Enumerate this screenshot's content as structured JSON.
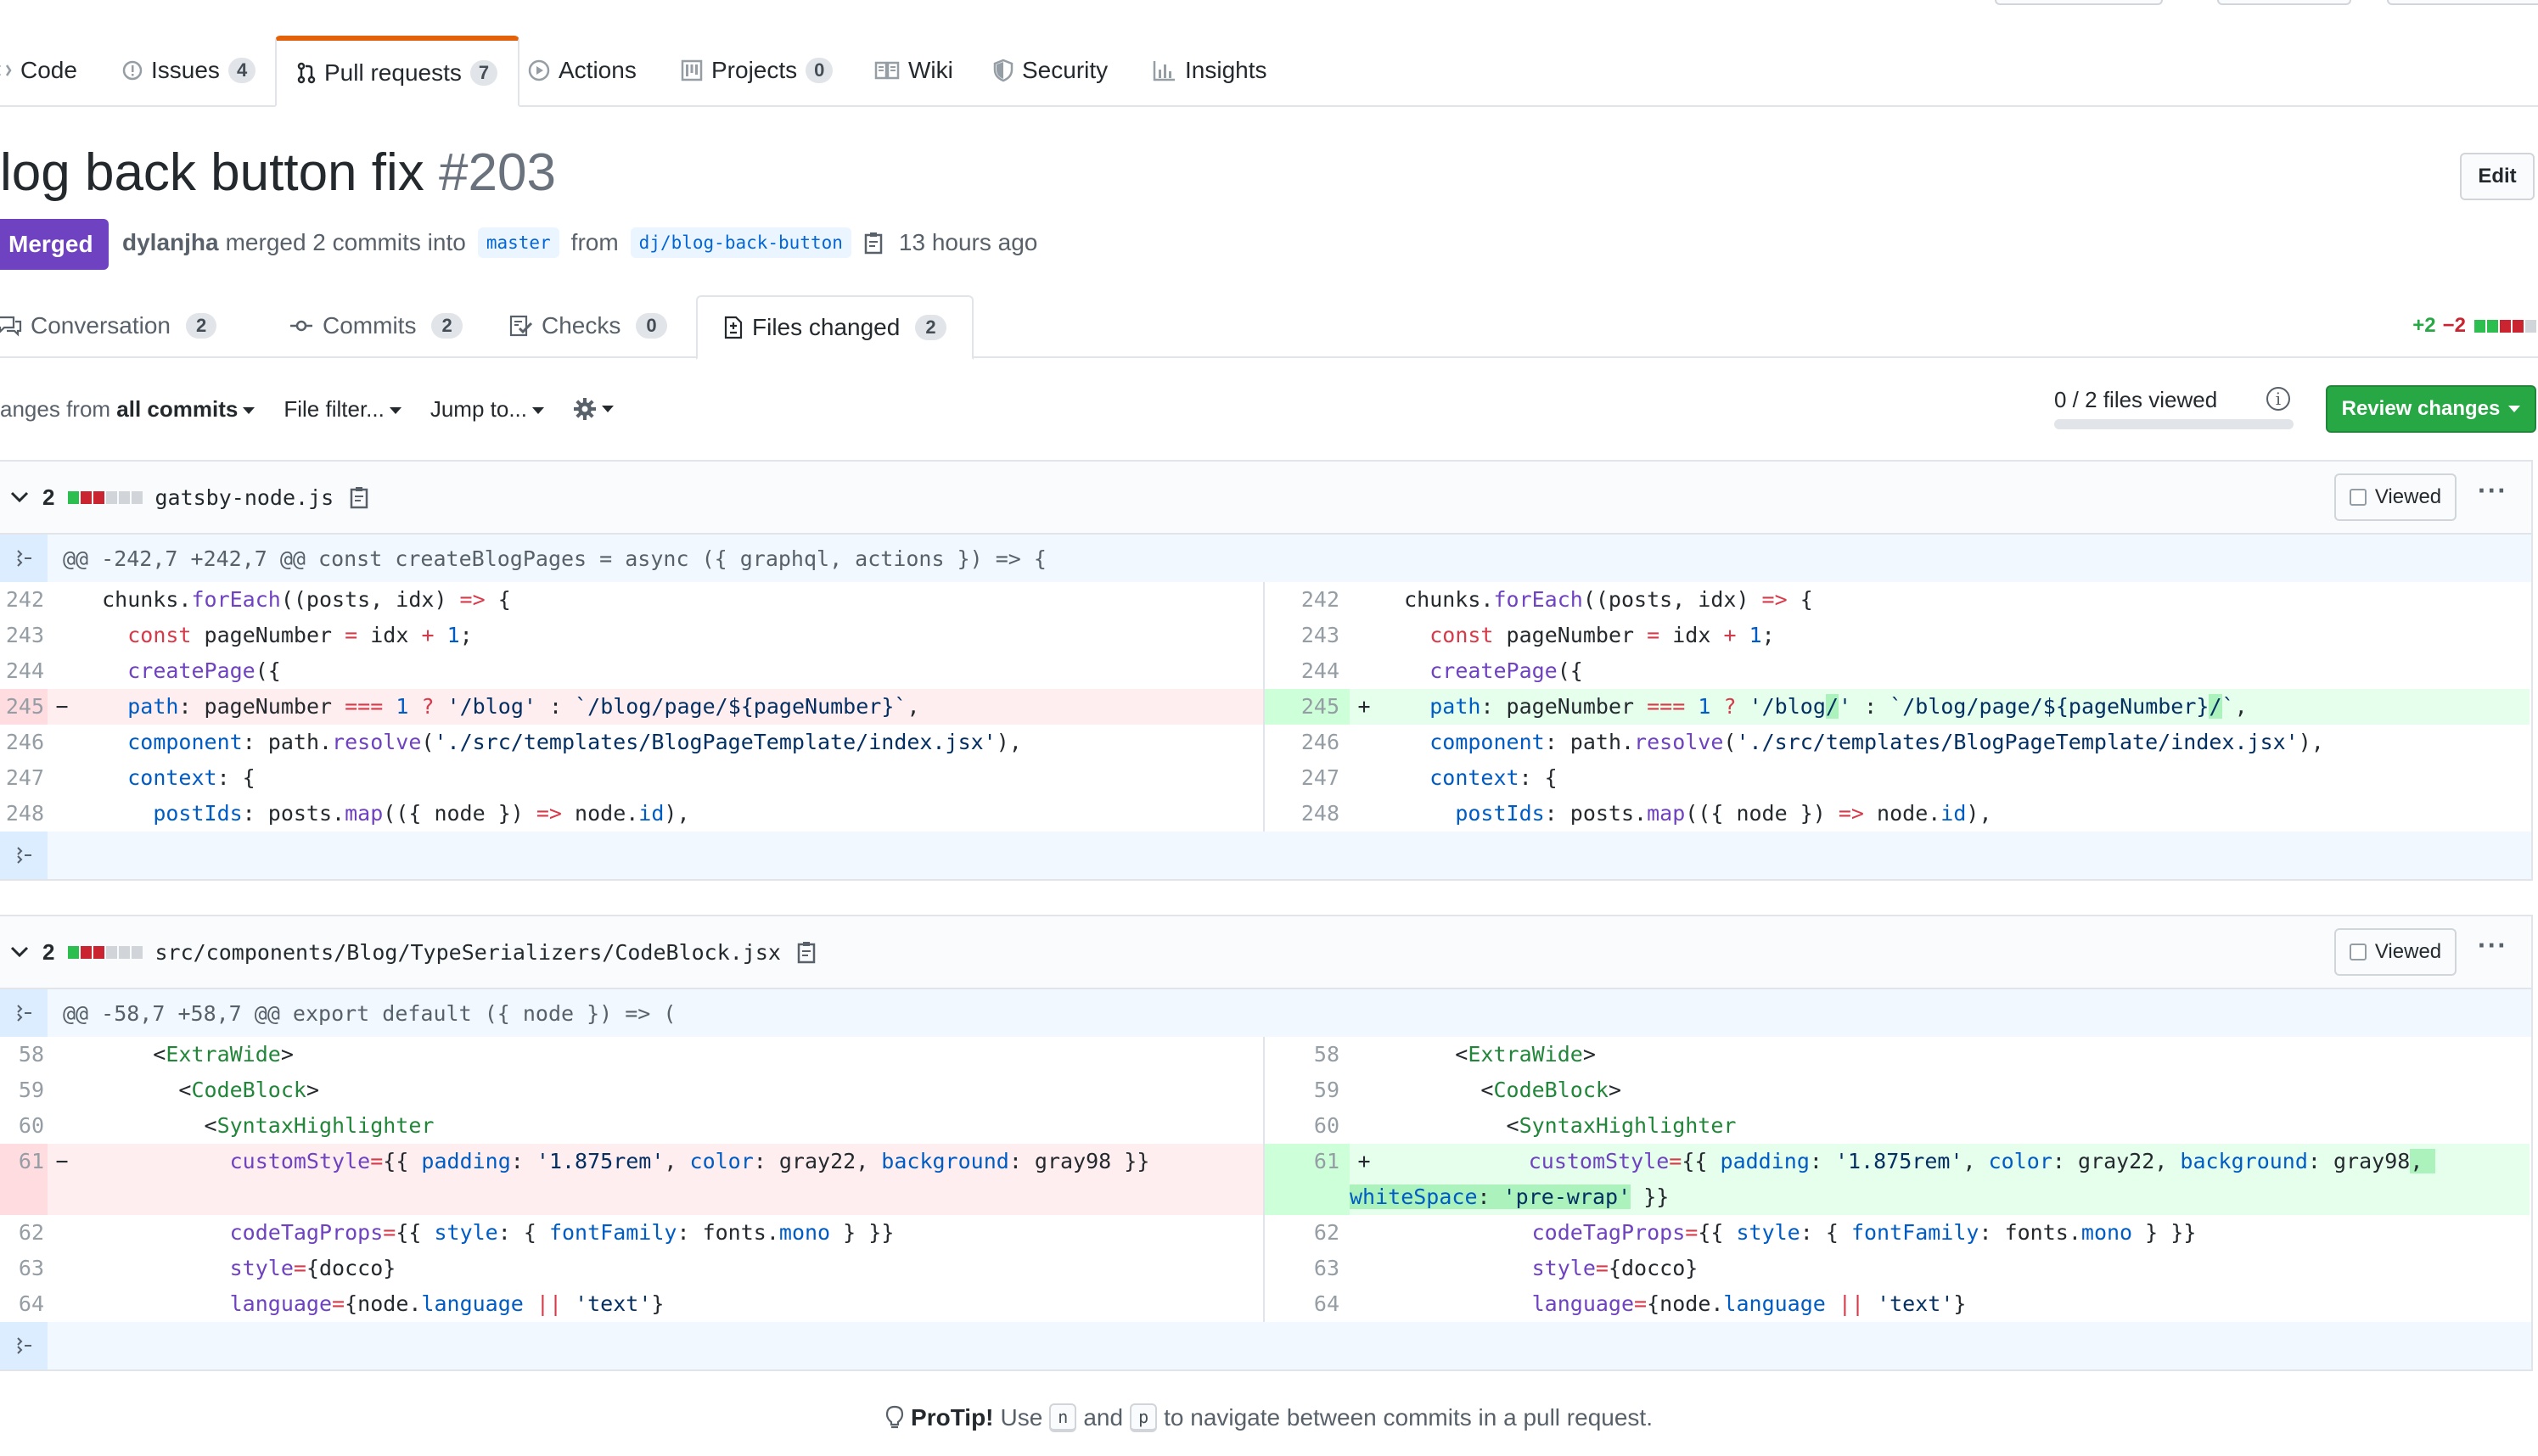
{
  "repo_nav": {
    "tabs": [
      {
        "label": "Code",
        "icon": "code-icon"
      },
      {
        "label": "Issues",
        "count": "4",
        "icon": "issue-icon"
      },
      {
        "label": "Pull requests",
        "count": "7",
        "icon": "pull-request-icon",
        "selected": true
      },
      {
        "label": "Actions",
        "icon": "play-icon"
      },
      {
        "label": "Projects",
        "count": "0",
        "icon": "project-icon"
      },
      {
        "label": "Wiki",
        "icon": "book-icon"
      },
      {
        "label": "Security",
        "icon": "shield-icon"
      },
      {
        "label": "Insights",
        "icon": "graph-icon"
      }
    ]
  },
  "pr": {
    "title": "log back button fix",
    "number": "#203",
    "edit_label": "Edit",
    "state": "Merged",
    "author": "dylanjha",
    "merge_text": "merged 2 commits into",
    "base_branch": "master",
    "from_text": "from",
    "head_branch": "dj/blog-back-button",
    "time": "13 hours ago"
  },
  "pr_tabs": [
    {
      "label": "Conversation",
      "count": "2",
      "icon": "comment-icon"
    },
    {
      "label": "Commits",
      "count": "2",
      "icon": "commit-icon"
    },
    {
      "label": "Checks",
      "count": "0",
      "icon": "checklist-icon"
    },
    {
      "label": "Files changed",
      "count": "2",
      "icon": "file-diff-icon",
      "selected": true
    }
  ],
  "diffstat": {
    "additions": "+2",
    "deletions": "−2",
    "colors": [
      "#2cbe4e",
      "#2cbe4e",
      "#cb2431",
      "#cb2431",
      "#d1d5da"
    ]
  },
  "toolbar": {
    "changes_prefix": "anges from ",
    "changes_value": "all commits",
    "file_filter": "File filter...",
    "jump_to": "Jump to...",
    "files_viewed": "0 / 2 files viewed",
    "review_button": "Review changes"
  },
  "files": [
    {
      "changes": "2",
      "path": "gatsby-node.js",
      "viewed_label": "Viewed",
      "hunk": "@@ -242,7 +242,7 @@ const createBlogPages = async ({ graphql, actions }) => {",
      "left_numbers": [
        "242",
        "243",
        "244",
        "245",
        "246",
        "247",
        "248"
      ],
      "right_numbers": [
        "242",
        "243",
        "244",
        "245",
        "246",
        "247",
        "248"
      ]
    },
    {
      "changes": "2",
      "path": "src/components/Blog/TypeSerializers/CodeBlock.jsx",
      "viewed_label": "Viewed",
      "hunk": "@@ -58,7 +58,7 @@ export default ({ node }) => (",
      "left_numbers": [
        "58",
        "59",
        "60",
        "61",
        "62",
        "63",
        "64"
      ],
      "right_numbers": [
        "58",
        "59",
        "60",
        "61",
        "62",
        "63",
        "64"
      ]
    }
  ],
  "protip": {
    "title": "ProTip!",
    "use": "Use",
    "key_n": "n",
    "and": "and",
    "key_p": "p",
    "rest": "to navigate between commits in a pull request."
  },
  "colors": {
    "merged": "#6f42c1",
    "review_button": "#28a745",
    "accent_tab": "#e36209"
  }
}
